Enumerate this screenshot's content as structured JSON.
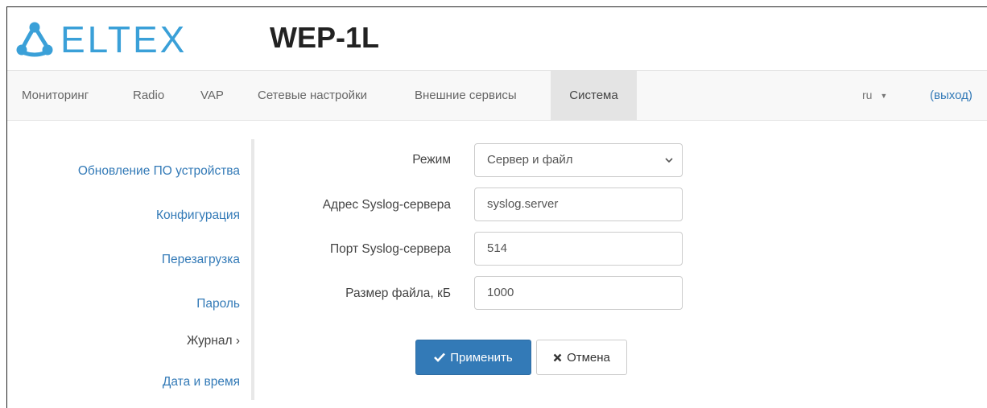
{
  "header": {
    "logo_text": "ELTEX",
    "device_title": "WEP-1L",
    "brand_color": "#3aa0d8"
  },
  "navbar": {
    "items": [
      {
        "label": "Мониторинг"
      },
      {
        "label": "Radio"
      },
      {
        "label": "VAP"
      },
      {
        "label": "Сетевые настройки"
      },
      {
        "label": "Внешние сервисы"
      },
      {
        "label": "Система",
        "active": true
      }
    ],
    "lang": "ru",
    "lang_icon": "caret-down-icon",
    "logout": "(выход)"
  },
  "sidebar": {
    "items": [
      {
        "label": "Обновление ПО устройства"
      },
      {
        "label": "Конфигурация"
      },
      {
        "label": "Перезагрузка"
      },
      {
        "label": "Пароль"
      },
      {
        "label": "Журнал ›",
        "current": true
      },
      {
        "label": "Дата и время"
      }
    ]
  },
  "form": {
    "mode_label": "Режим",
    "mode_value": "Сервер и файл",
    "syslog_address_label": "Адрес Syslog-сервера",
    "syslog_address_value": "syslog.server",
    "syslog_port_label": "Порт Syslog-сервера",
    "syslog_port_value": "514",
    "file_size_label": "Размер файла, кБ",
    "file_size_value": "1000"
  },
  "buttons": {
    "apply_label": "Применить",
    "apply_icon": "check-icon",
    "cancel_label": "Отмена",
    "cancel_icon": "times-icon"
  },
  "colors": {
    "accent": "#337ab7",
    "nav_bg": "#f8f8f8",
    "nav_active_bg": "#e4e4e4"
  }
}
